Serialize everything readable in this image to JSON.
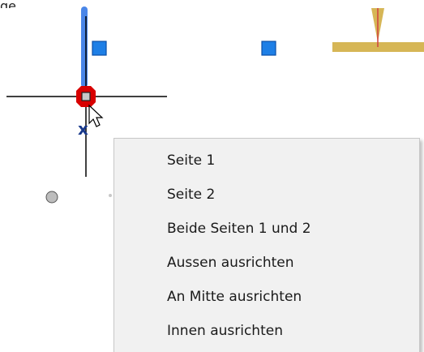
{
  "header": {
    "partial_label": "ge"
  },
  "context_menu": {
    "items": [
      {
        "label": "Seite 1"
      },
      {
        "label": "Seite 2"
      },
      {
        "label": "Beide Seiten 1 und 2"
      },
      {
        "label": "Aussen ausrichten"
      },
      {
        "label": "An Mitte ausrichten"
      },
      {
        "label": "Innen ausrichten"
      }
    ]
  },
  "colors": {
    "crosshair": "#000000",
    "grip_fill": "#1e7fe6",
    "selection_highlight": "#4a86e8",
    "snap_marker": "#e00000",
    "beam": "#d6b656"
  },
  "icons": [
    "crosshair-cursor",
    "pointer-cursor-icon",
    "snap-marker-icon",
    "x-marker-icon"
  ]
}
